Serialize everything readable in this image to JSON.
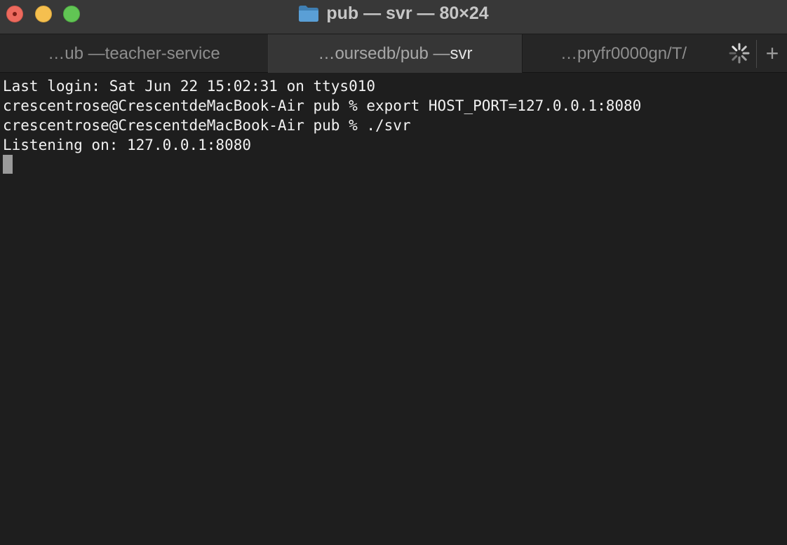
{
  "window": {
    "title": "pub — svr — 80×24",
    "traffic_lights": {
      "close": "#ed6a5e",
      "minimize": "#f5bf4f",
      "zoom": "#61c554"
    }
  },
  "tabs": [
    {
      "label_lead": "…ub — ",
      "label_main": "teacher-service",
      "active": false
    },
    {
      "label_lead": "…oursedb/pub — ",
      "label_main": "svr",
      "active": true
    },
    {
      "label_lead": "…pryfr0000gn/T/",
      "label_main": "",
      "active": false
    }
  ],
  "tabbar": {
    "new_tab_label": "+",
    "spinner_icon": "activity-spinner-icon"
  },
  "terminal": {
    "lines": [
      "Last login: Sat Jun 22 15:02:31 on ttys010",
      "crescentrose@CrescentdeMacBook-Air pub % export HOST_PORT=127.0.0.1:8080",
      "crescentrose@CrescentdeMacBook-Air pub % ./svr",
      "Listening on: 127.0.0.1:8080"
    ],
    "mark_glyph": "[",
    "background": "#1e1e1e",
    "foreground": "#f2f2f2"
  }
}
